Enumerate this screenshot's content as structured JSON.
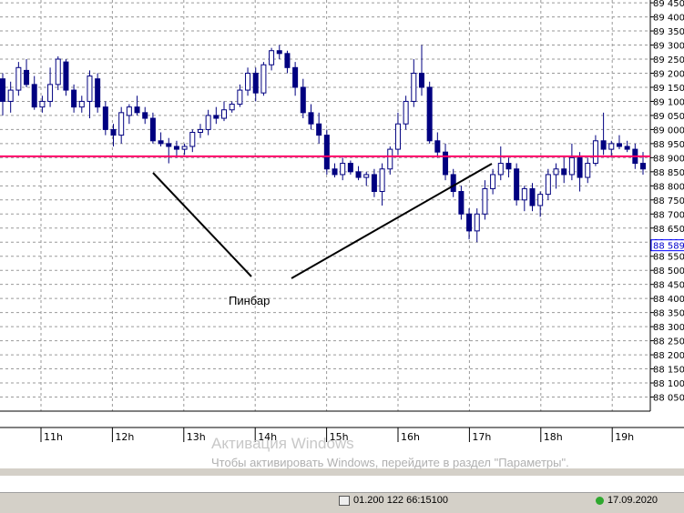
{
  "chart_data": {
    "type": "candlestick",
    "ylim": [
      88.0,
      89.46
    ],
    "grid": true,
    "y_ticks": [
      "89 450",
      "89 400",
      "89 350",
      "89 300",
      "89 250",
      "89 200",
      "89 150",
      "89 100",
      "89 050",
      "89 000",
      "88 950",
      "88 900",
      "88 850",
      "88 800",
      "88 750",
      "88 700",
      "88 650",
      "88 600",
      "88 550",
      "88 500",
      "88 450",
      "88 400",
      "88 350",
      "88 300",
      "88 250",
      "88 200",
      "88 150",
      "88 100",
      "88 050"
    ],
    "x_ticks": [
      "11h",
      "12h",
      "13h",
      "14h",
      "15h",
      "16h",
      "17h",
      "18h",
      "19h"
    ],
    "current_price_label": "88 589",
    "current_price": 88.589,
    "horizontal_level": 88.905,
    "annotation": "Пинбар",
    "candles": [
      [
        89.18,
        89.2,
        89.05,
        89.1
      ],
      [
        89.1,
        89.17,
        89.06,
        89.14
      ],
      [
        89.14,
        89.24,
        89.12,
        89.22
      ],
      [
        89.21,
        89.25,
        89.15,
        89.16
      ],
      [
        89.16,
        89.19,
        89.07,
        89.08
      ],
      [
        89.08,
        89.12,
        89.06,
        89.1
      ],
      [
        89.1,
        89.22,
        89.08,
        89.16
      ],
      [
        89.16,
        89.26,
        89.14,
        89.25
      ],
      [
        89.24,
        89.25,
        89.12,
        89.14
      ],
      [
        89.14,
        89.16,
        89.06,
        89.08
      ],
      [
        89.08,
        89.12,
        89.06,
        89.1
      ],
      [
        89.1,
        89.21,
        89.04,
        89.19
      ],
      [
        89.18,
        89.2,
        89.06,
        89.08
      ],
      [
        89.08,
        89.1,
        88.98,
        89.0
      ],
      [
        89.0,
        89.02,
        88.94,
        88.98
      ],
      [
        88.98,
        89.08,
        88.95,
        89.06
      ],
      [
        89.05,
        89.09,
        89.02,
        89.08
      ],
      [
        89.08,
        89.12,
        89.05,
        89.06
      ],
      [
        89.06,
        89.08,
        89.02,
        89.04
      ],
      [
        89.04,
        89.06,
        88.95,
        88.96
      ],
      [
        88.96,
        88.99,
        88.94,
        88.95
      ],
      [
        88.95,
        88.97,
        88.88,
        88.94
      ],
      [
        88.94,
        88.96,
        88.9,
        88.93
      ],
      [
        88.93,
        88.95,
        88.91,
        88.94
      ],
      [
        88.94,
        89.0,
        88.92,
        88.99
      ],
      [
        88.99,
        89.02,
        88.97,
        89.0
      ],
      [
        89.0,
        89.07,
        88.98,
        89.05
      ],
      [
        89.05,
        89.08,
        89.02,
        89.04
      ],
      [
        89.04,
        89.1,
        89.03,
        89.07
      ],
      [
        89.07,
        89.1,
        89.06,
        89.09
      ],
      [
        89.09,
        89.16,
        89.08,
        89.14
      ],
      [
        89.14,
        89.22,
        89.12,
        89.2
      ],
      [
        89.2,
        89.22,
        89.1,
        89.13
      ],
      [
        89.13,
        89.24,
        89.12,
        89.23
      ],
      [
        89.23,
        89.29,
        89.21,
        89.28
      ],
      [
        89.28,
        89.3,
        89.25,
        89.27
      ],
      [
        89.27,
        89.28,
        89.2,
        89.22
      ],
      [
        89.22,
        89.24,
        89.12,
        89.15
      ],
      [
        89.15,
        89.18,
        89.04,
        89.06
      ],
      [
        89.06,
        89.09,
        89.0,
        89.02
      ],
      [
        89.02,
        89.06,
        88.95,
        88.98
      ],
      [
        88.98,
        89.0,
        88.84,
        88.86
      ],
      [
        88.86,
        88.88,
        88.83,
        88.84
      ],
      [
        88.84,
        88.9,
        88.82,
        88.88
      ],
      [
        88.88,
        88.89,
        88.84,
        88.85
      ],
      [
        88.85,
        88.87,
        88.82,
        88.83
      ],
      [
        88.83,
        88.85,
        88.8,
        88.84
      ],
      [
        88.84,
        88.86,
        88.76,
        88.78
      ],
      [
        88.78,
        88.88,
        88.73,
        88.86
      ],
      [
        88.86,
        88.94,
        88.84,
        88.93
      ],
      [
        88.93,
        89.06,
        88.91,
        89.02
      ],
      [
        89.02,
        89.12,
        89.0,
        89.1
      ],
      [
        89.1,
        89.25,
        89.08,
        89.2
      ],
      [
        89.2,
        89.3,
        89.12,
        89.15
      ],
      [
        89.15,
        89.17,
        88.95,
        88.96
      ],
      [
        88.96,
        88.99,
        88.9,
        88.92
      ],
      [
        88.92,
        88.95,
        88.82,
        88.84
      ],
      [
        88.84,
        88.86,
        88.76,
        88.78
      ],
      [
        88.78,
        88.8,
        88.68,
        88.7
      ],
      [
        88.7,
        88.72,
        88.61,
        88.64
      ],
      [
        88.64,
        88.72,
        88.6,
        88.7
      ],
      [
        88.7,
        88.82,
        88.68,
        88.79
      ],
      [
        88.79,
        88.86,
        88.77,
        88.84
      ],
      [
        88.84,
        88.94,
        88.82,
        88.88
      ],
      [
        88.88,
        88.9,
        88.83,
        88.86
      ],
      [
        88.86,
        88.88,
        88.73,
        88.75
      ],
      [
        88.75,
        88.8,
        88.71,
        88.79
      ],
      [
        88.79,
        88.81,
        88.71,
        88.73
      ],
      [
        88.73,
        88.78,
        88.69,
        88.77
      ],
      [
        88.77,
        88.86,
        88.75,
        88.84
      ],
      [
        88.84,
        88.88,
        88.79,
        88.86
      ],
      [
        88.86,
        88.9,
        88.81,
        88.84
      ],
      [
        88.84,
        88.95,
        88.82,
        88.9
      ],
      [
        88.9,
        88.92,
        88.78,
        88.83
      ],
      [
        88.83,
        88.9,
        88.81,
        88.88
      ],
      [
        88.88,
        88.98,
        88.87,
        88.96
      ],
      [
        88.96,
        89.06,
        88.91,
        88.93
      ],
      [
        88.93,
        88.96,
        88.9,
        88.95
      ],
      [
        88.95,
        88.98,
        88.93,
        88.94
      ],
      [
        88.94,
        88.96,
        88.92,
        88.93
      ],
      [
        88.93,
        88.95,
        88.86,
        88.88
      ],
      [
        88.88,
        88.92,
        88.84,
        88.86
      ]
    ]
  },
  "watermark": {
    "title": "Активация Windows",
    "subtitle": "Чтобы активировать Windows, перейдите в раздел \"Параметры\"."
  },
  "statusbar": {
    "item1": "01.200   122   66:15100",
    "item2": "17.09.2020"
  }
}
